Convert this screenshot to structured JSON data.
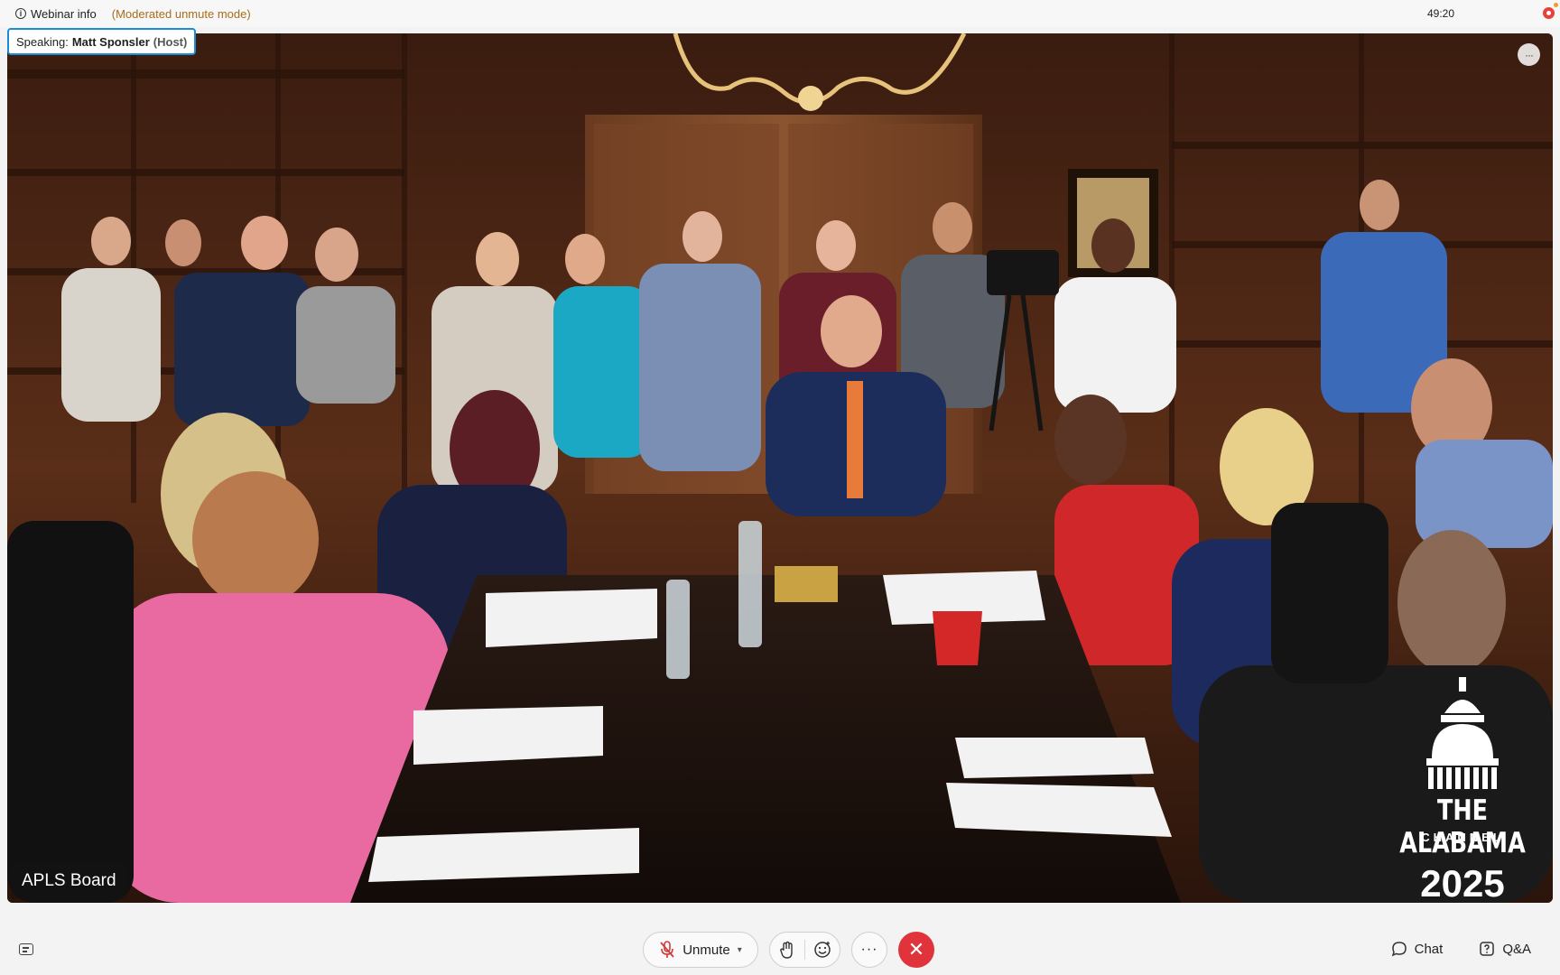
{
  "topbar": {
    "webinar_info_label": "Webinar info",
    "mode_label": "(Moderated unmute mode)",
    "timer": "49:20"
  },
  "video": {
    "speaking_prefix": "Speaking:",
    "speaker_name": "Matt Sponsler",
    "speaker_role": "(Host)",
    "participant_label": "APLS Board",
    "watermark": {
      "line1": "THE ALABAMA",
      "line2": "CHANNEL",
      "year": "2025"
    }
  },
  "controls": {
    "unmute_label": "Unmute",
    "more_label": "···",
    "chat_label": "Chat",
    "qa_label": "Q&A"
  },
  "colors": {
    "accent_blue": "#1d8bd6",
    "leave_red": "#e1333c",
    "mode_text": "#a86c1a",
    "recording": "#e8403a"
  },
  "icons": [
    "info-icon",
    "recording-icon",
    "more-options-icon",
    "captions-icon",
    "mic-muted-icon",
    "raise-hand-icon",
    "reactions-icon",
    "leave-icon",
    "chat-icon",
    "qa-icon"
  ]
}
